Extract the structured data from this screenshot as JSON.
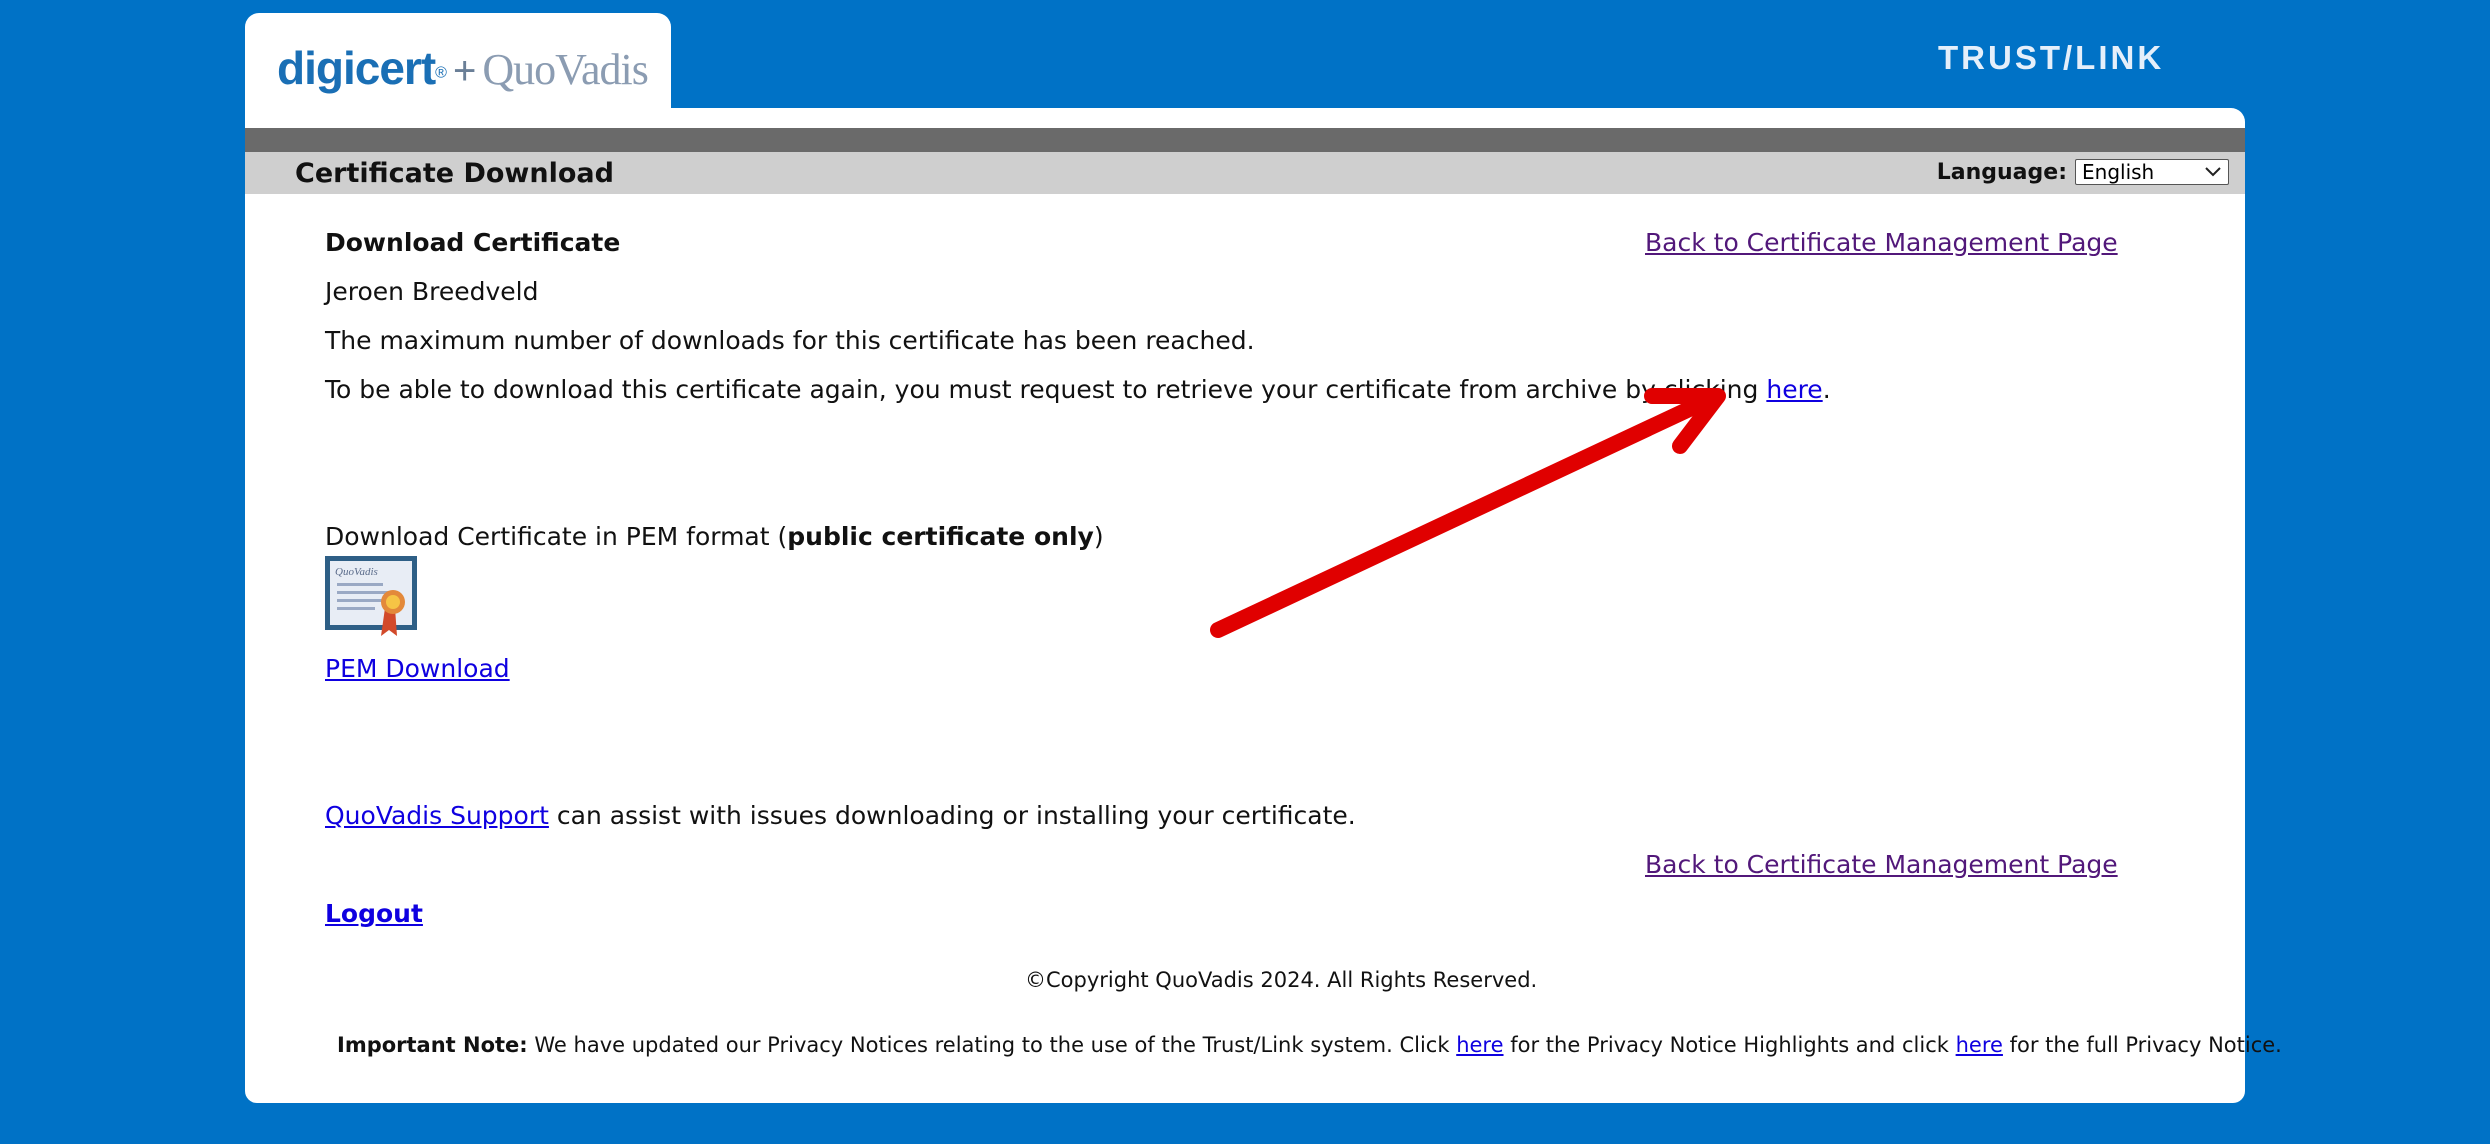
{
  "header": {
    "logo_text": "digicert® + QuoVadis",
    "brand": "TRUST/LINK"
  },
  "titlebar": {
    "title": "Certificate Download",
    "language_label": "Language:",
    "language_selected": "English"
  },
  "main": {
    "heading": "Download Certificate",
    "back_link": "Back to Certificate Management Page",
    "name": "Jeroen Breedveld",
    "max_downloads_msg": "The maximum number of downloads for this certificate has been reached.",
    "retrieve_msg": "To be able to download this certificate again, you must request to retrieve your certificate from archive by clicking",
    "retrieve_link": "here",
    "retrieve_end": ".",
    "pem_text_prefix": "Download Certificate in PEM format (",
    "pem_text_bold": "public certificate only",
    "pem_text_suffix": ")",
    "pem_link": "PEM Download",
    "support_link": "QuoVadis Support",
    "support_text": "can assist with issues downloading or installing your certificate.",
    "back_link_bottom": "Back to Certificate Management Page",
    "logout": "Logout"
  },
  "footer": {
    "copyright": "©Copyright QuoVadis 2024. All Rights Reserved.",
    "note_label": "Important Note:",
    "note_text_1": "We have updated our Privacy Notices relating to the use of the Trust/Link system. Click",
    "note_link_1": "here",
    "note_text_2": "for the Privacy Notice Highlights and click",
    "note_link_2": "here",
    "note_text_3": "for the full Privacy Notice."
  },
  "colors": {
    "background": "#0072C6",
    "annotation_arrow": "#E00000",
    "link": "#0F00E0",
    "visited_link": "#52187A"
  },
  "icons": [
    "certificate-icon",
    "chevron-down-icon",
    "annotation-arrow"
  ]
}
